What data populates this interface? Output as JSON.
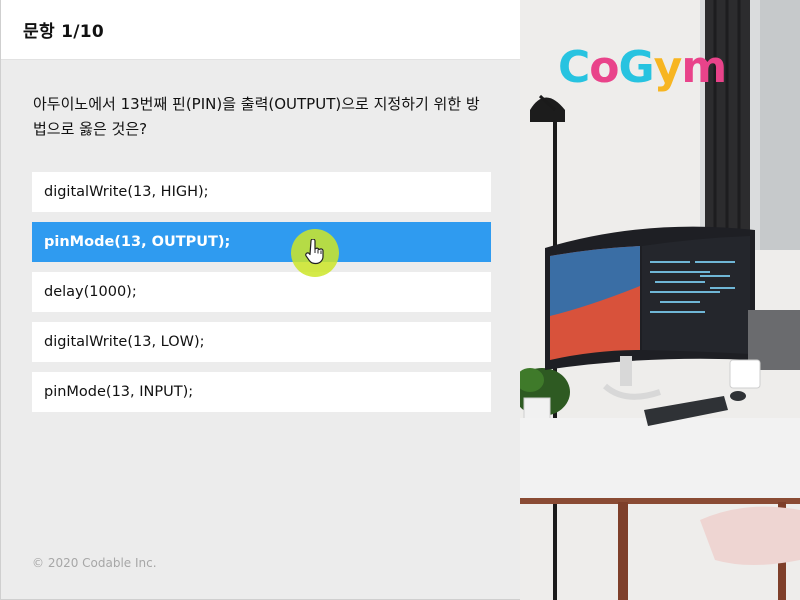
{
  "header": {
    "title": "문항 1/10"
  },
  "question": {
    "text": "아두이노에서 13번째 핀(PIN)을 출력(OUTPUT)으로 지정하기 위한 방법으로 옳은 것은?"
  },
  "choices": [
    {
      "label": "digitalWrite(13, HIGH);",
      "selected": false
    },
    {
      "label": "pinMode(13, OUTPUT);",
      "selected": true
    },
    {
      "label": "delay(1000);",
      "selected": false
    },
    {
      "label": "digitalWrite(13, LOW);",
      "selected": false
    },
    {
      "label": "pinMode(13, INPUT);",
      "selected": false
    }
  ],
  "footer": {
    "copyright": "© 2020 Codable Inc."
  },
  "logo": {
    "letters": [
      "C",
      "o",
      "G",
      "y",
      "m"
    ],
    "colors": [
      "#27c3e0",
      "#e9438a",
      "#27c3e0",
      "#f7b521",
      "#e9438a"
    ]
  },
  "colors": {
    "selected": "#2f9bf0",
    "cursor_highlight": "#cde628"
  },
  "icons": {
    "cursor": "hand-pointer-icon"
  }
}
